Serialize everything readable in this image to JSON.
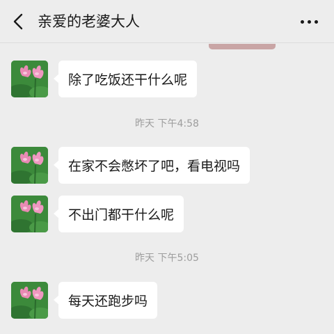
{
  "header": {
    "back_icon": "chevron-left-icon",
    "title": "亲爱的老婆大人",
    "more_icon": "more-dots-icon"
  },
  "messages": [
    {
      "type": "received",
      "avatar": "lotus-avatar",
      "text": "除了吃饭还干什么呢"
    },
    {
      "type": "timestamp",
      "text": "昨天 下午4:58"
    },
    {
      "type": "received",
      "avatar": "lotus-avatar",
      "text": "在家不会憋坏了吧，看电视吗"
    },
    {
      "type": "received",
      "avatar": "lotus-avatar",
      "text": "不出门都干什么呢"
    },
    {
      "type": "timestamp",
      "text": "昨天 下午5:05"
    },
    {
      "type": "received",
      "avatar": "lotus-avatar",
      "text": "每天还跑步吗"
    }
  ],
  "colors": {
    "background": "#ededed",
    "bubble_received": "#ffffff",
    "timestamp_text": "#9d9d9d",
    "sent_bubble_partial": "#c9a5a5"
  }
}
